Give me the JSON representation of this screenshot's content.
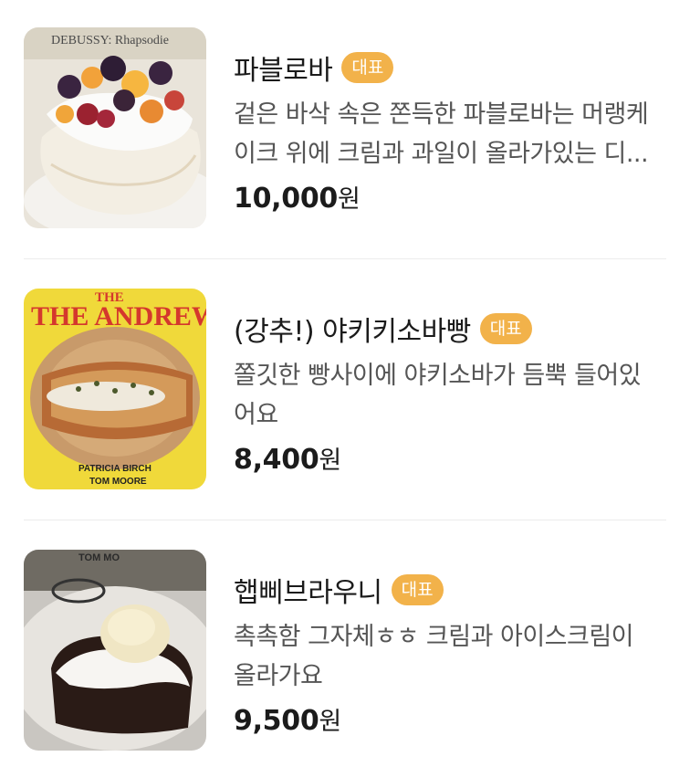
{
  "menu": {
    "items": [
      {
        "name": "파블로바",
        "badge": "대표",
        "description": "겉은 바삭 속은 쫀득한 파블로바는 머랭케이크 위에 크림과 과일이 올라가있는 디...",
        "price": "10,000",
        "currency": "원",
        "photo_text": "DEBUSSY: Rhapsodie"
      },
      {
        "name": "(강추!) 야키키소바빵",
        "badge": "대표",
        "description": "쫄깃한 빵사이에 야키소바가 듬뿍 들어있어요",
        "price": "8,400",
        "currency": "원",
        "photo_text": "THE ANDREWS",
        "photo_credits": [
          "PATRICIA BIRCH",
          "TOM MOORE"
        ]
      },
      {
        "name": "햅삐브라우니",
        "badge": "대표",
        "description": "촉촉함 그자체ㅎㅎ 크림과 아이스크림이 올라가요",
        "price": "9,500",
        "currency": "원",
        "photo_text": "TOM MO"
      }
    ]
  },
  "colors": {
    "badge": "#f2b24a",
    "divider": "#ececec"
  }
}
